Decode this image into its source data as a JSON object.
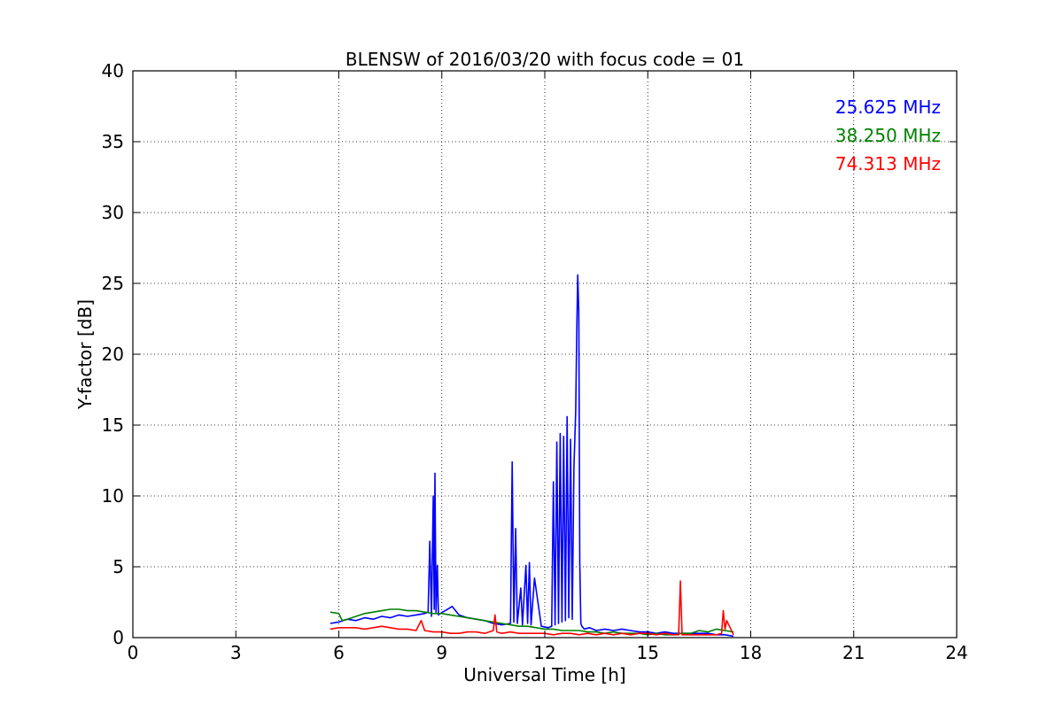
{
  "chart_data": {
    "type": "line",
    "title": "BLENSW of 2016/03/20 with focus code = 01",
    "xlabel": "Universal Time [h]",
    "ylabel": "Y-factor [dB]",
    "xlim": [
      0,
      24
    ],
    "ylim": [
      0,
      40
    ],
    "x_ticks": [
      0,
      3,
      6,
      9,
      12,
      15,
      18,
      21,
      24
    ],
    "y_ticks": [
      0,
      5,
      10,
      15,
      20,
      25,
      30,
      35,
      40
    ],
    "x_tick_labels": [
      "0",
      "3",
      "6",
      "9",
      "12",
      "15",
      "18",
      "21",
      "24"
    ],
    "y_tick_labels": [
      "0",
      "5",
      "10",
      "15",
      "20",
      "25",
      "30",
      "35",
      "40"
    ],
    "grid": true,
    "legend_placement": "top-right",
    "series": [
      {
        "name": "25.625 MHz",
        "color": "#0000ff",
        "x": [
          5.75,
          6.0,
          6.25,
          6.5,
          6.75,
          7.0,
          7.25,
          7.5,
          7.75,
          8.0,
          8.25,
          8.5,
          8.6,
          8.65,
          8.7,
          8.75,
          8.78,
          8.8,
          8.83,
          8.87,
          8.9,
          8.95,
          9.1,
          9.3,
          9.5,
          9.75,
          10.0,
          10.25,
          10.5,
          10.75,
          11.0,
          11.05,
          11.1,
          11.15,
          11.2,
          11.3,
          11.35,
          11.45,
          11.5,
          11.55,
          11.6,
          11.7,
          11.9,
          12.1,
          12.2,
          12.25,
          12.3,
          12.35,
          12.4,
          12.45,
          12.5,
          12.55,
          12.6,
          12.65,
          12.7,
          12.75,
          12.8,
          12.85,
          12.9,
          12.93,
          12.96,
          12.99,
          13.02,
          13.05,
          13.08,
          13.15,
          13.3,
          13.5,
          13.75,
          14.0,
          14.25,
          14.5,
          14.75,
          15.0,
          15.25,
          15.5,
          15.75,
          16.0,
          16.25,
          16.5,
          16.75,
          17.0,
          17.25,
          17.5
        ],
        "y": [
          1.0,
          1.1,
          1.3,
          1.2,
          1.4,
          1.3,
          1.5,
          1.4,
          1.6,
          1.5,
          1.6,
          1.7,
          1.8,
          6.8,
          1.5,
          10.0,
          2.0,
          11.6,
          1.8,
          5.1,
          1.6,
          1.7,
          1.9,
          2.2,
          1.6,
          1.4,
          1.3,
          1.2,
          1.0,
          0.9,
          1.0,
          12.4,
          1.1,
          7.7,
          1.0,
          3.5,
          0.9,
          5.1,
          1.0,
          5.3,
          0.9,
          4.2,
          0.8,
          0.7,
          0.8,
          11.0,
          0.9,
          13.8,
          1.0,
          14.4,
          1.1,
          14.2,
          1.2,
          15.6,
          1.4,
          14.0,
          1.3,
          12.0,
          16.0,
          21.2,
          25.6,
          23.0,
          5.3,
          1.0,
          0.8,
          0.6,
          0.7,
          0.5,
          0.6,
          0.5,
          0.6,
          0.5,
          0.4,
          0.4,
          0.3,
          0.4,
          0.3,
          0.3,
          0.3,
          0.3,
          0.3,
          0.2,
          0.2,
          0.1
        ]
      },
      {
        "name": "38.250 MHz",
        "color": "#008000",
        "x": [
          5.75,
          6.0,
          6.1,
          6.25,
          6.5,
          6.75,
          7.0,
          7.25,
          7.5,
          7.75,
          8.0,
          8.25,
          8.5,
          8.75,
          9.0,
          9.25,
          9.5,
          9.75,
          10.0,
          10.25,
          10.5,
          10.75,
          11.0,
          11.25,
          11.5,
          11.75,
          12.0,
          12.25,
          12.5,
          12.75,
          13.0,
          13.25,
          13.5,
          13.75,
          14.0,
          14.25,
          14.5,
          14.75,
          15.0,
          15.25,
          15.5,
          15.75,
          16.0,
          16.25,
          16.5,
          16.75,
          17.0,
          17.25,
          17.5
        ],
        "y": [
          1.8,
          1.7,
          1.2,
          1.3,
          1.5,
          1.7,
          1.8,
          1.9,
          2.0,
          2.0,
          1.9,
          1.9,
          1.8,
          1.7,
          1.7,
          1.6,
          1.5,
          1.4,
          1.3,
          1.2,
          1.1,
          1.0,
          0.9,
          0.8,
          0.8,
          0.7,
          0.6,
          0.6,
          0.5,
          0.5,
          0.5,
          0.4,
          0.4,
          0.3,
          0.4,
          0.3,
          0.3,
          0.3,
          0.2,
          0.3,
          0.2,
          0.2,
          0.3,
          0.3,
          0.5,
          0.4,
          0.6,
          0.5,
          0.4
        ]
      },
      {
        "name": "74.313 MHz",
        "color": "#ff0000",
        "x": [
          5.75,
          6.0,
          6.25,
          6.5,
          6.75,
          7.0,
          7.25,
          7.5,
          7.75,
          8.0,
          8.25,
          8.4,
          8.5,
          8.75,
          9.0,
          9.25,
          9.5,
          9.75,
          10.0,
          10.25,
          10.5,
          10.55,
          10.6,
          10.75,
          11.0,
          11.25,
          11.5,
          11.75,
          12.0,
          12.25,
          12.5,
          12.75,
          13.0,
          13.25,
          13.5,
          13.75,
          14.0,
          14.25,
          14.5,
          14.75,
          15.0,
          15.25,
          15.5,
          15.75,
          15.9,
          15.95,
          16.0,
          16.25,
          16.5,
          16.75,
          17.0,
          17.15,
          17.2,
          17.25,
          17.3,
          17.5
        ],
        "y": [
          0.6,
          0.7,
          0.7,
          0.7,
          0.6,
          0.7,
          0.8,
          0.7,
          0.6,
          0.6,
          0.5,
          1.2,
          0.5,
          0.4,
          0.4,
          0.3,
          0.3,
          0.4,
          0.4,
          0.3,
          0.5,
          1.6,
          0.4,
          0.3,
          0.4,
          0.3,
          0.3,
          0.3,
          0.3,
          0.2,
          0.3,
          0.3,
          0.2,
          0.3,
          0.2,
          0.3,
          0.2,
          0.3,
          0.2,
          0.3,
          0.3,
          0.2,
          0.3,
          0.2,
          0.2,
          4.0,
          0.2,
          0.2,
          0.2,
          0.2,
          0.2,
          0.3,
          1.9,
          0.6,
          1.2,
          0.2
        ]
      }
    ]
  }
}
